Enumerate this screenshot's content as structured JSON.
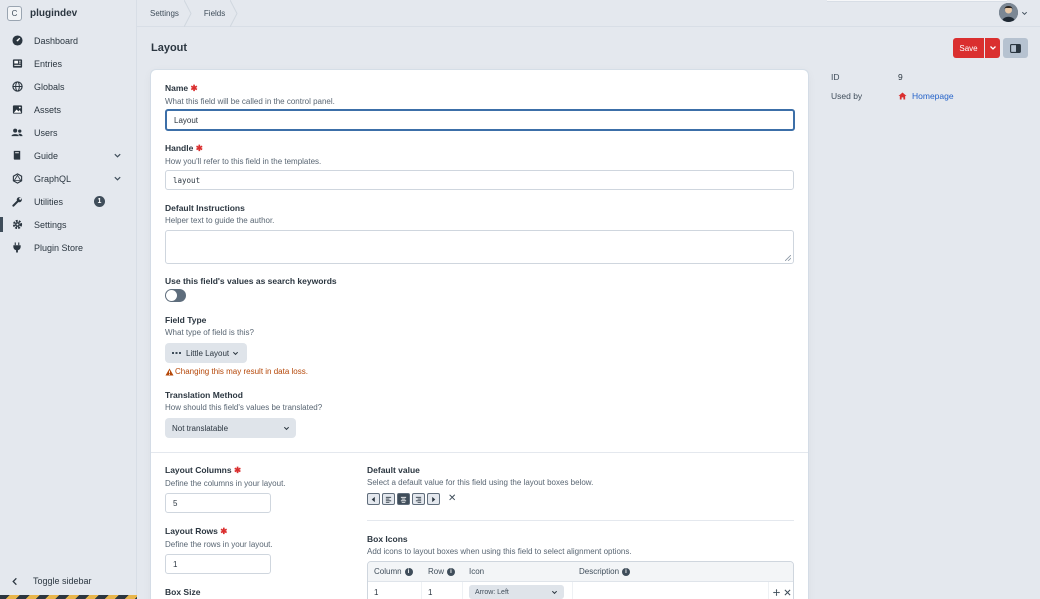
{
  "app": {
    "site_initial": "C",
    "site_name": "plugindev"
  },
  "sidebar": {
    "items": [
      {
        "label": "Dashboard",
        "icon": "gauge-icon"
      },
      {
        "label": "Entries",
        "icon": "newspaper-icon"
      },
      {
        "label": "Globals",
        "icon": "globe-icon"
      },
      {
        "label": "Assets",
        "icon": "image-icon"
      },
      {
        "label": "Users",
        "icon": "users-icon"
      },
      {
        "label": "Guide",
        "icon": "book-icon",
        "expandable": true
      },
      {
        "label": "GraphQL",
        "icon": "graphql-icon",
        "expandable": true
      },
      {
        "label": "Utilities",
        "icon": "wrench-icon",
        "badge": "1"
      },
      {
        "label": "Settings",
        "icon": "gear-icon",
        "selected": true
      },
      {
        "label": "Plugin Store",
        "icon": "plug-icon"
      }
    ],
    "toggle_label": "Toggle sidebar"
  },
  "header": {
    "breadcrumbs": [
      "Settings",
      "Fields"
    ]
  },
  "page": {
    "title": "Layout",
    "save_label": "Save"
  },
  "form": {
    "name": {
      "label": "Name",
      "instructions": "What this field will be called in the control panel.",
      "value": "Layout"
    },
    "handle": {
      "label": "Handle",
      "instructions": "How you'll refer to this field in the templates.",
      "value": "layout"
    },
    "default_instructions": {
      "label": "Default Instructions",
      "instructions": "Helper text to guide the author.",
      "value": ""
    },
    "search_keywords": {
      "label": "Use this field's values as search keywords",
      "enabled": false
    },
    "field_type": {
      "label": "Field Type",
      "instructions": "What type of field is this?",
      "value": "Little Layout",
      "warning": "Changing this may result in data loss."
    },
    "translation": {
      "label": "Translation Method",
      "instructions": "How should this field's values be translated?",
      "value": "Not translatable"
    },
    "layout_columns": {
      "label": "Layout Columns",
      "instructions": "Define the columns in your layout.",
      "value": "5"
    },
    "layout_rows": {
      "label": "Layout Rows",
      "instructions": "Define the rows in your layout.",
      "value": "1"
    },
    "box_size": {
      "label": "Box Size"
    },
    "default_value": {
      "label": "Default value",
      "instructions": "Select a default value for this field using the layout boxes below.",
      "boxes": [
        "arrow-left-icon",
        "align-left-icon",
        "align-center-icon",
        "align-right-icon",
        "arrow-right-icon"
      ],
      "selected_index": 2
    },
    "box_icons": {
      "label": "Box Icons",
      "instructions": "Add icons to layout boxes when using this field to select alignment options.",
      "columns": [
        "Column",
        "Row",
        "Icon",
        "Description"
      ],
      "rows": [
        {
          "column": "1",
          "row": "1",
          "icon": "Arrow: Left",
          "description": ""
        }
      ]
    }
  },
  "meta": {
    "id_label": "ID",
    "id_value": "9",
    "used_by_label": "Used by",
    "used_by_value": "Homepage"
  },
  "colors": {
    "accent_red": "#da2f2f",
    "link_blue": "#2563c9",
    "warning": "#b54708"
  }
}
